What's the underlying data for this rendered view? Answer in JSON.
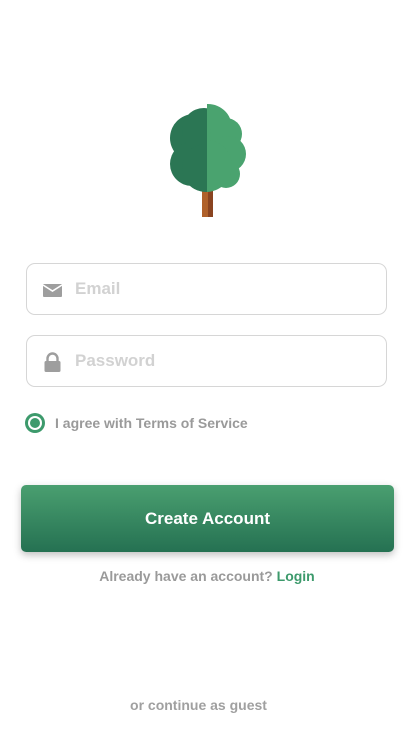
{
  "logo": {
    "icon": "tree-icon"
  },
  "form": {
    "email": {
      "icon": "envelope-icon",
      "placeholder": "Email",
      "value": ""
    },
    "password": {
      "icon": "lock-icon",
      "placeholder": "Password",
      "value": ""
    },
    "agree": {
      "label": "I agree with Terms of Service",
      "checked": true
    },
    "create_label": "Create Account"
  },
  "footer": {
    "have_account": "Already have an account?",
    "login_label": "Login",
    "guest_label": "or continue as guest"
  },
  "colors": {
    "accent": "#3d9a6c",
    "button_top": "#4a9f70",
    "button_bottom": "#257152",
    "muted_text": "#9a9a9a",
    "border": "#d6d6d6"
  }
}
